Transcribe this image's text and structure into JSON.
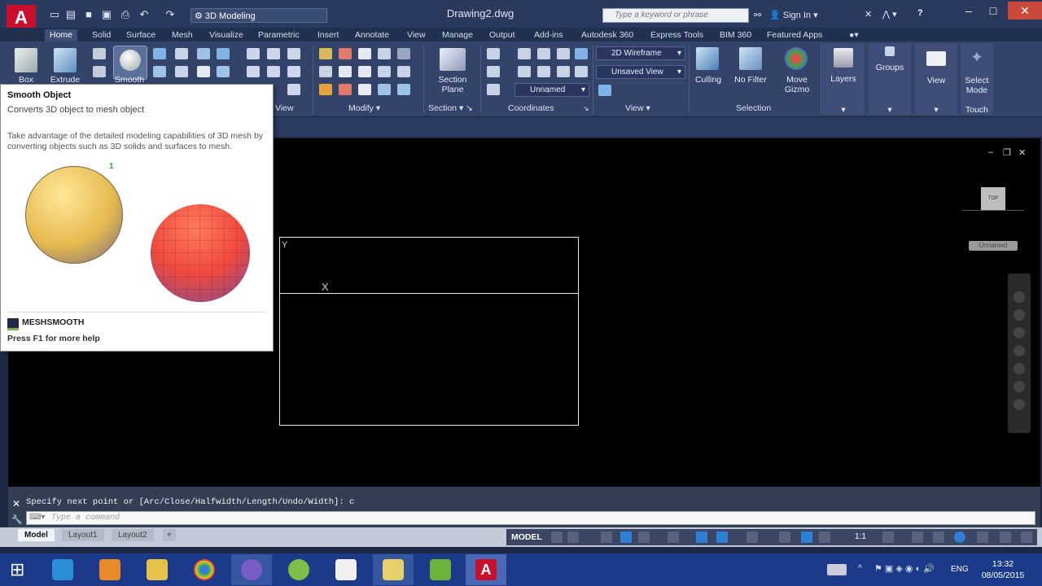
{
  "app": {
    "logo": "A",
    "workspace": "3D Modeling",
    "document_title": "Drawing2.dwg",
    "search_placeholder": "Type a keyword or phrase",
    "signin_label": "Sign In",
    "help_label": "?"
  },
  "ribbon_tabs": [
    "Home",
    "Solid",
    "Surface",
    "Mesh",
    "Visualize",
    "Parametric",
    "Insert",
    "Annotate",
    "View",
    "Manage",
    "Output",
    "Add-ins",
    "Autodesk 360",
    "Express Tools",
    "BIM 360",
    "Featured Apps"
  ],
  "ribbon": {
    "box_label": "Box",
    "extrude_label": "Extrude",
    "smooth_label": "Smooth",
    "section_plane_label": "Section Plane",
    "visual_style": "2D Wireframe",
    "view_dropdown": "Unsaved View",
    "coord_dropdown": "Unnamed",
    "culling_label": "Culling",
    "no_filter_label": "No Filter",
    "move_gizmo_label": "Move Gizmo",
    "layers_label": "Layers",
    "groups_label": "Groups",
    "view_label": "View",
    "select_mode_label": "Select Mode",
    "touch_label": "Touch",
    "panels": {
      "view": "View",
      "modify": "Modify",
      "section": "Section",
      "coordinates": "Coordinates",
      "view2": "View",
      "selection": "Selection"
    }
  },
  "tooltip": {
    "title": "Smooth Object",
    "subtitle": "Converts 3D object to mesh object",
    "description": "Take advantage of the detailed modeling capabilities of 3D mesh by converting objects such as 3D solids and surfaces to mesh.",
    "marker": "1",
    "command": "MESHSMOOTH",
    "help": "Press F1 for more help"
  },
  "viewport": {
    "viewcube_label": "TOP",
    "wcs_label": "Unnamed",
    "ucs_y": "Y",
    "ucs_x": "X"
  },
  "command_line": {
    "history": "Specify next point or [Arc/Close/Halfwidth/Length/Undo/Width]: c",
    "placeholder": "Type a command"
  },
  "layout_tabs": [
    "Model",
    "Layout1",
    "Layout2"
  ],
  "status_bar": {
    "model_label": "MODEL",
    "scale": "1:1"
  },
  "taskbar": {
    "time": "13:32",
    "date": "08/05/2015",
    "language": "ENG"
  },
  "colors": {
    "autocad_red": "#c8102e",
    "ribbon_bg": "#34436a",
    "canvas_bg": "#000000",
    "taskbar_bg": "#1b3a8a"
  }
}
